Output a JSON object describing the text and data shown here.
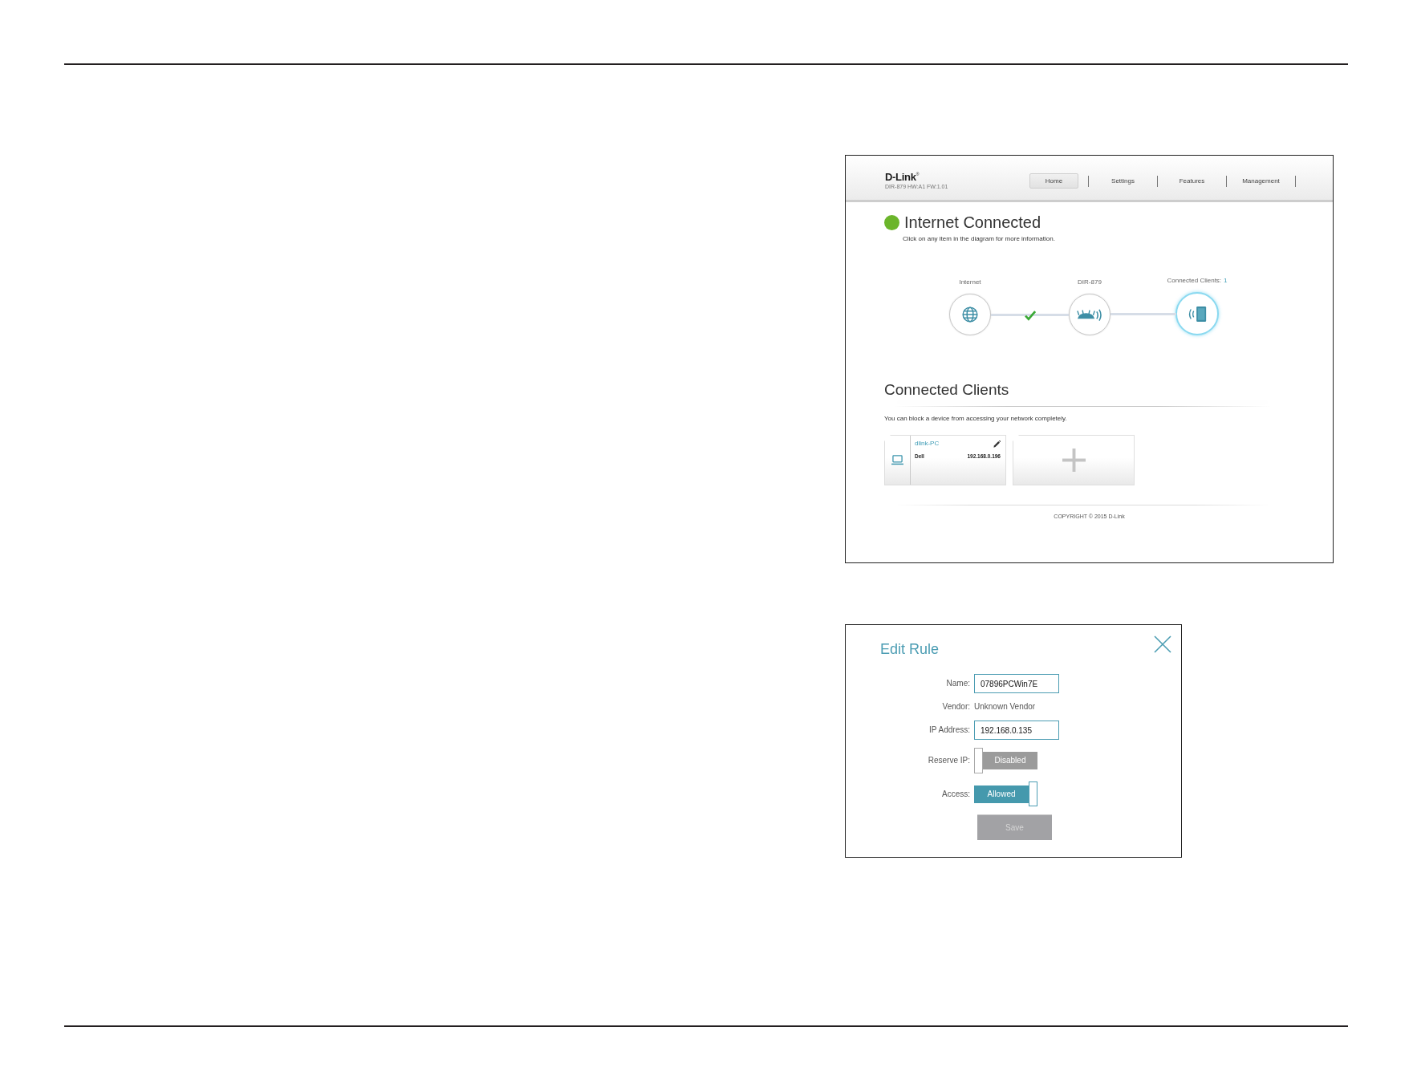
{
  "router_screenshot": {
    "header": {
      "logo": "D-Link$^{®}$",
      "model_info": "DIR-879 HW:A1 FW:1.01",
      "nav": [
        {
          "label": "Home",
          "selected": true
        },
        {
          "label": "Settings",
          "selected": false
        },
        {
          "label": "Features",
          "selected": false
        },
        {
          "label": "Management",
          "selected": false
        }
      ]
    },
    "status": {
      "connected": true,
      "title": "Internet Connected",
      "hint": "Click on any item in the diagram for more information."
    },
    "diagram": {
      "nodes": [
        {
          "kind": "internet",
          "label": "Internet",
          "selected": false
        },
        {
          "kind": "router",
          "label": "DIR-879",
          "selected": false
        },
        {
          "kind": "clients",
          "label": "Connected Clients:",
          "count": "1",
          "selected": true
        }
      ],
      "links": [
        {
          "checked": true
        },
        {
          "checked": false
        }
      ]
    },
    "clients_section": {
      "title": "Connected Clients",
      "description": "You can block a device from accessing your network completely.",
      "clients": [
        {
          "name": "dlink-PC",
          "vendor": "Dell",
          "ip": "192.168.0.196"
        }
      ]
    },
    "footer": {
      "copyright": "COPYRIGHT © 2015 D-Link"
    }
  },
  "edit_rule_dialog": {
    "title": "Edit Rule",
    "fields": [
      {
        "kind": "input",
        "label": "Name:",
        "value": "07896PCWin7E"
      },
      {
        "kind": "text",
        "label": "Vendor:",
        "value": "Unknown Vendor"
      },
      {
        "kind": "input",
        "label": "IP Address:",
        "value": "192.168.0.135"
      },
      {
        "kind": "toggle",
        "label": "Reserve IP:",
        "on": false,
        "state_label": "Disabled"
      },
      {
        "kind": "toggle",
        "label": "Access:",
        "on": true,
        "state_label": "Allowed"
      }
    ],
    "save_button": {
      "label": "Save",
      "disabled": true
    }
  }
}
